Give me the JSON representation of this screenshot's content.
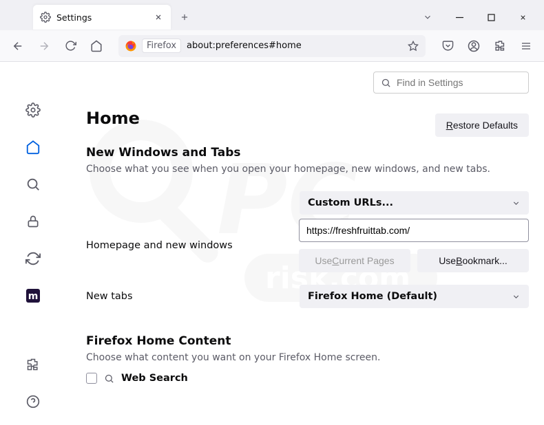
{
  "tab": {
    "title": "Settings"
  },
  "toolbar": {
    "identity": "Firefox",
    "url": "about:preferences#home"
  },
  "search": {
    "placeholder": "Find in Settings"
  },
  "page": {
    "heading": "Home",
    "restore_label": "Restore Defaults",
    "restore_ul": "R",
    "restore_rest": "estore Defaults"
  },
  "section1": {
    "title": "New Windows and Tabs",
    "desc": "Choose what you see when you open your homepage, new windows, and new tabs.",
    "row1_label": "Homepage and new windows",
    "row1_select": "Custom URLs...",
    "row1_input": "https://freshfruittab.com/",
    "use_current_pre": "Use ",
    "use_current_ul": "C",
    "use_current_post": "urrent Pages",
    "use_bookmark_pre": "Use ",
    "use_bookmark_ul": "B",
    "use_bookmark_post": "ookmark...",
    "row2_label": "New tabs",
    "row2_select": "Firefox Home (Default)"
  },
  "section2": {
    "title": "Firefox Home Content",
    "desc": "Choose what content you want on your Firefox Home screen.",
    "check1": "Web Search"
  }
}
